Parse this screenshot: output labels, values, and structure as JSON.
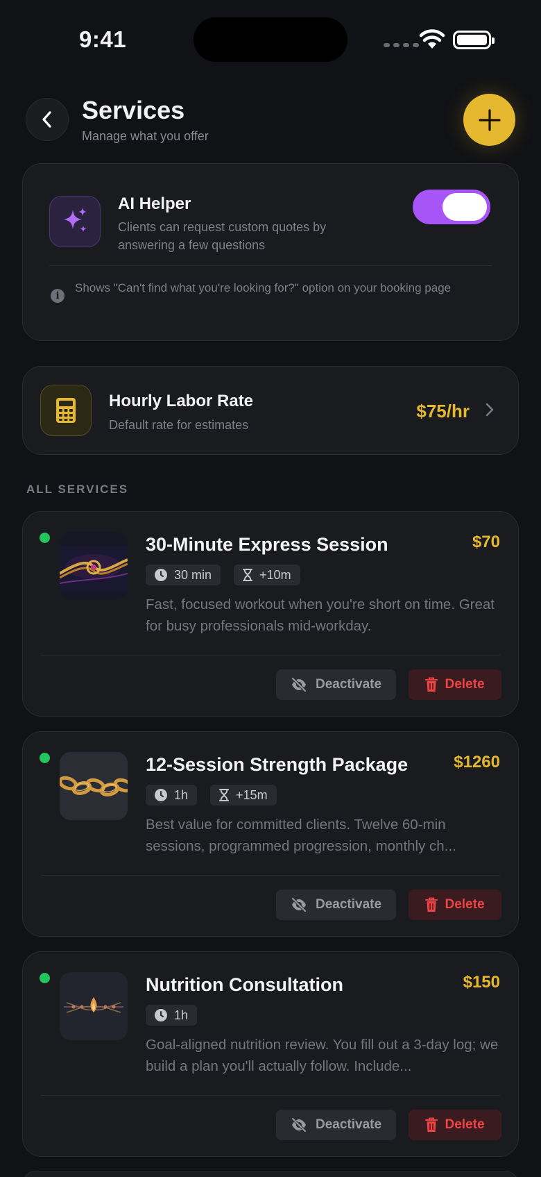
{
  "status": {
    "time": "9:41"
  },
  "header": {
    "title": "Services",
    "subtitle": "Manage what you offer"
  },
  "ai_helper": {
    "title": "AI Helper",
    "description": "Clients can request custom quotes by answering a few questions",
    "note": "Shows \"Can't find what you're looking for?\" option on your booking page",
    "enabled": true,
    "accent": "#a855f7"
  },
  "labor": {
    "title": "Hourly Labor Rate",
    "subtitle": "Default rate for estimates",
    "rate": "$75/hr"
  },
  "section_label": "ALL SERVICES",
  "actions": {
    "deactivate": "Deactivate",
    "delete": "Delete"
  },
  "services": [
    {
      "title": "30-Minute Express Session",
      "price": "$70",
      "duration": "30 min",
      "buffer": "+10m",
      "description": "Fast, focused workout when you're short on time. Great for busy professionals mid-workday.",
      "active": true
    },
    {
      "title": "12-Session Strength Package",
      "price": "$1260",
      "duration": "1h",
      "buffer": "+15m",
      "description": "Best value for committed clients. Twelve 60-min sessions, programmed progression, monthly ch...",
      "active": true
    },
    {
      "title": "Nutrition Consultation",
      "price": "$150",
      "duration": "1h",
      "buffer": null,
      "description": "Goal-aligned nutrition review. You fill out a 3-day log; we build a plan you'll actually follow. Include...",
      "active": true
    }
  ],
  "colors": {
    "accent": "#e6b830",
    "active": "#22c55e",
    "danger": "#ef4444",
    "background": "#111215"
  }
}
